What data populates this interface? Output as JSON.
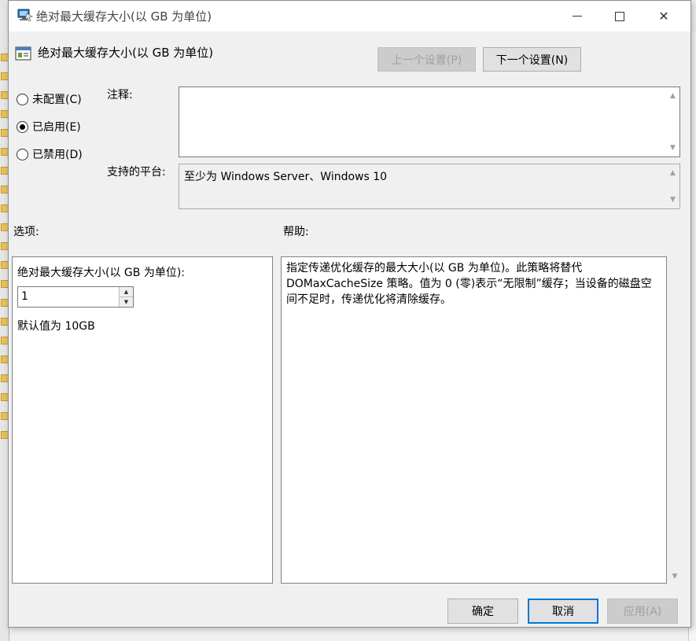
{
  "window": {
    "title": "绝对最大缓存大小(以 GB 为单位)",
    "minimize_icon": "minimize-icon",
    "maximize_icon": "maximize-icon",
    "close_glyph": "✕"
  },
  "header": {
    "title": "绝对最大缓存大小(以 GB 为单位)"
  },
  "nav": {
    "prev_label": "上一个设置(P)",
    "next_label": "下一个设置(N)"
  },
  "state": {
    "options": [
      {
        "label": "未配置(C)",
        "checked": false
      },
      {
        "label": "已启用(E)",
        "checked": true
      },
      {
        "label": "已禁用(D)",
        "checked": false
      }
    ]
  },
  "comment": {
    "label": "注释:",
    "value": ""
  },
  "platform": {
    "label": "支持的平台:",
    "value": "至少为 Windows Server、Windows 10"
  },
  "options_section": {
    "label": "选项:",
    "field_label": "绝对最大缓存大小(以 GB 为单位):",
    "value": "1",
    "default_text": "默认值为 10GB"
  },
  "help_section": {
    "label": "帮助:",
    "text": "指定传递优化缓存的最大大小(以 GB 为单位)。此策略将替代 DOMaxCacheSize 策略。值为 0 (零)表示“无限制”缓存；当设备的磁盘空间不足时，传递优化将清除缓存。"
  },
  "footer": {
    "ok_label": "确定",
    "cancel_label": "取消",
    "apply_label": "应用(A)"
  },
  "colors": {
    "accent": "#0078d7",
    "window_bg": "#f0f0f0",
    "folder": "#e8c15a"
  }
}
